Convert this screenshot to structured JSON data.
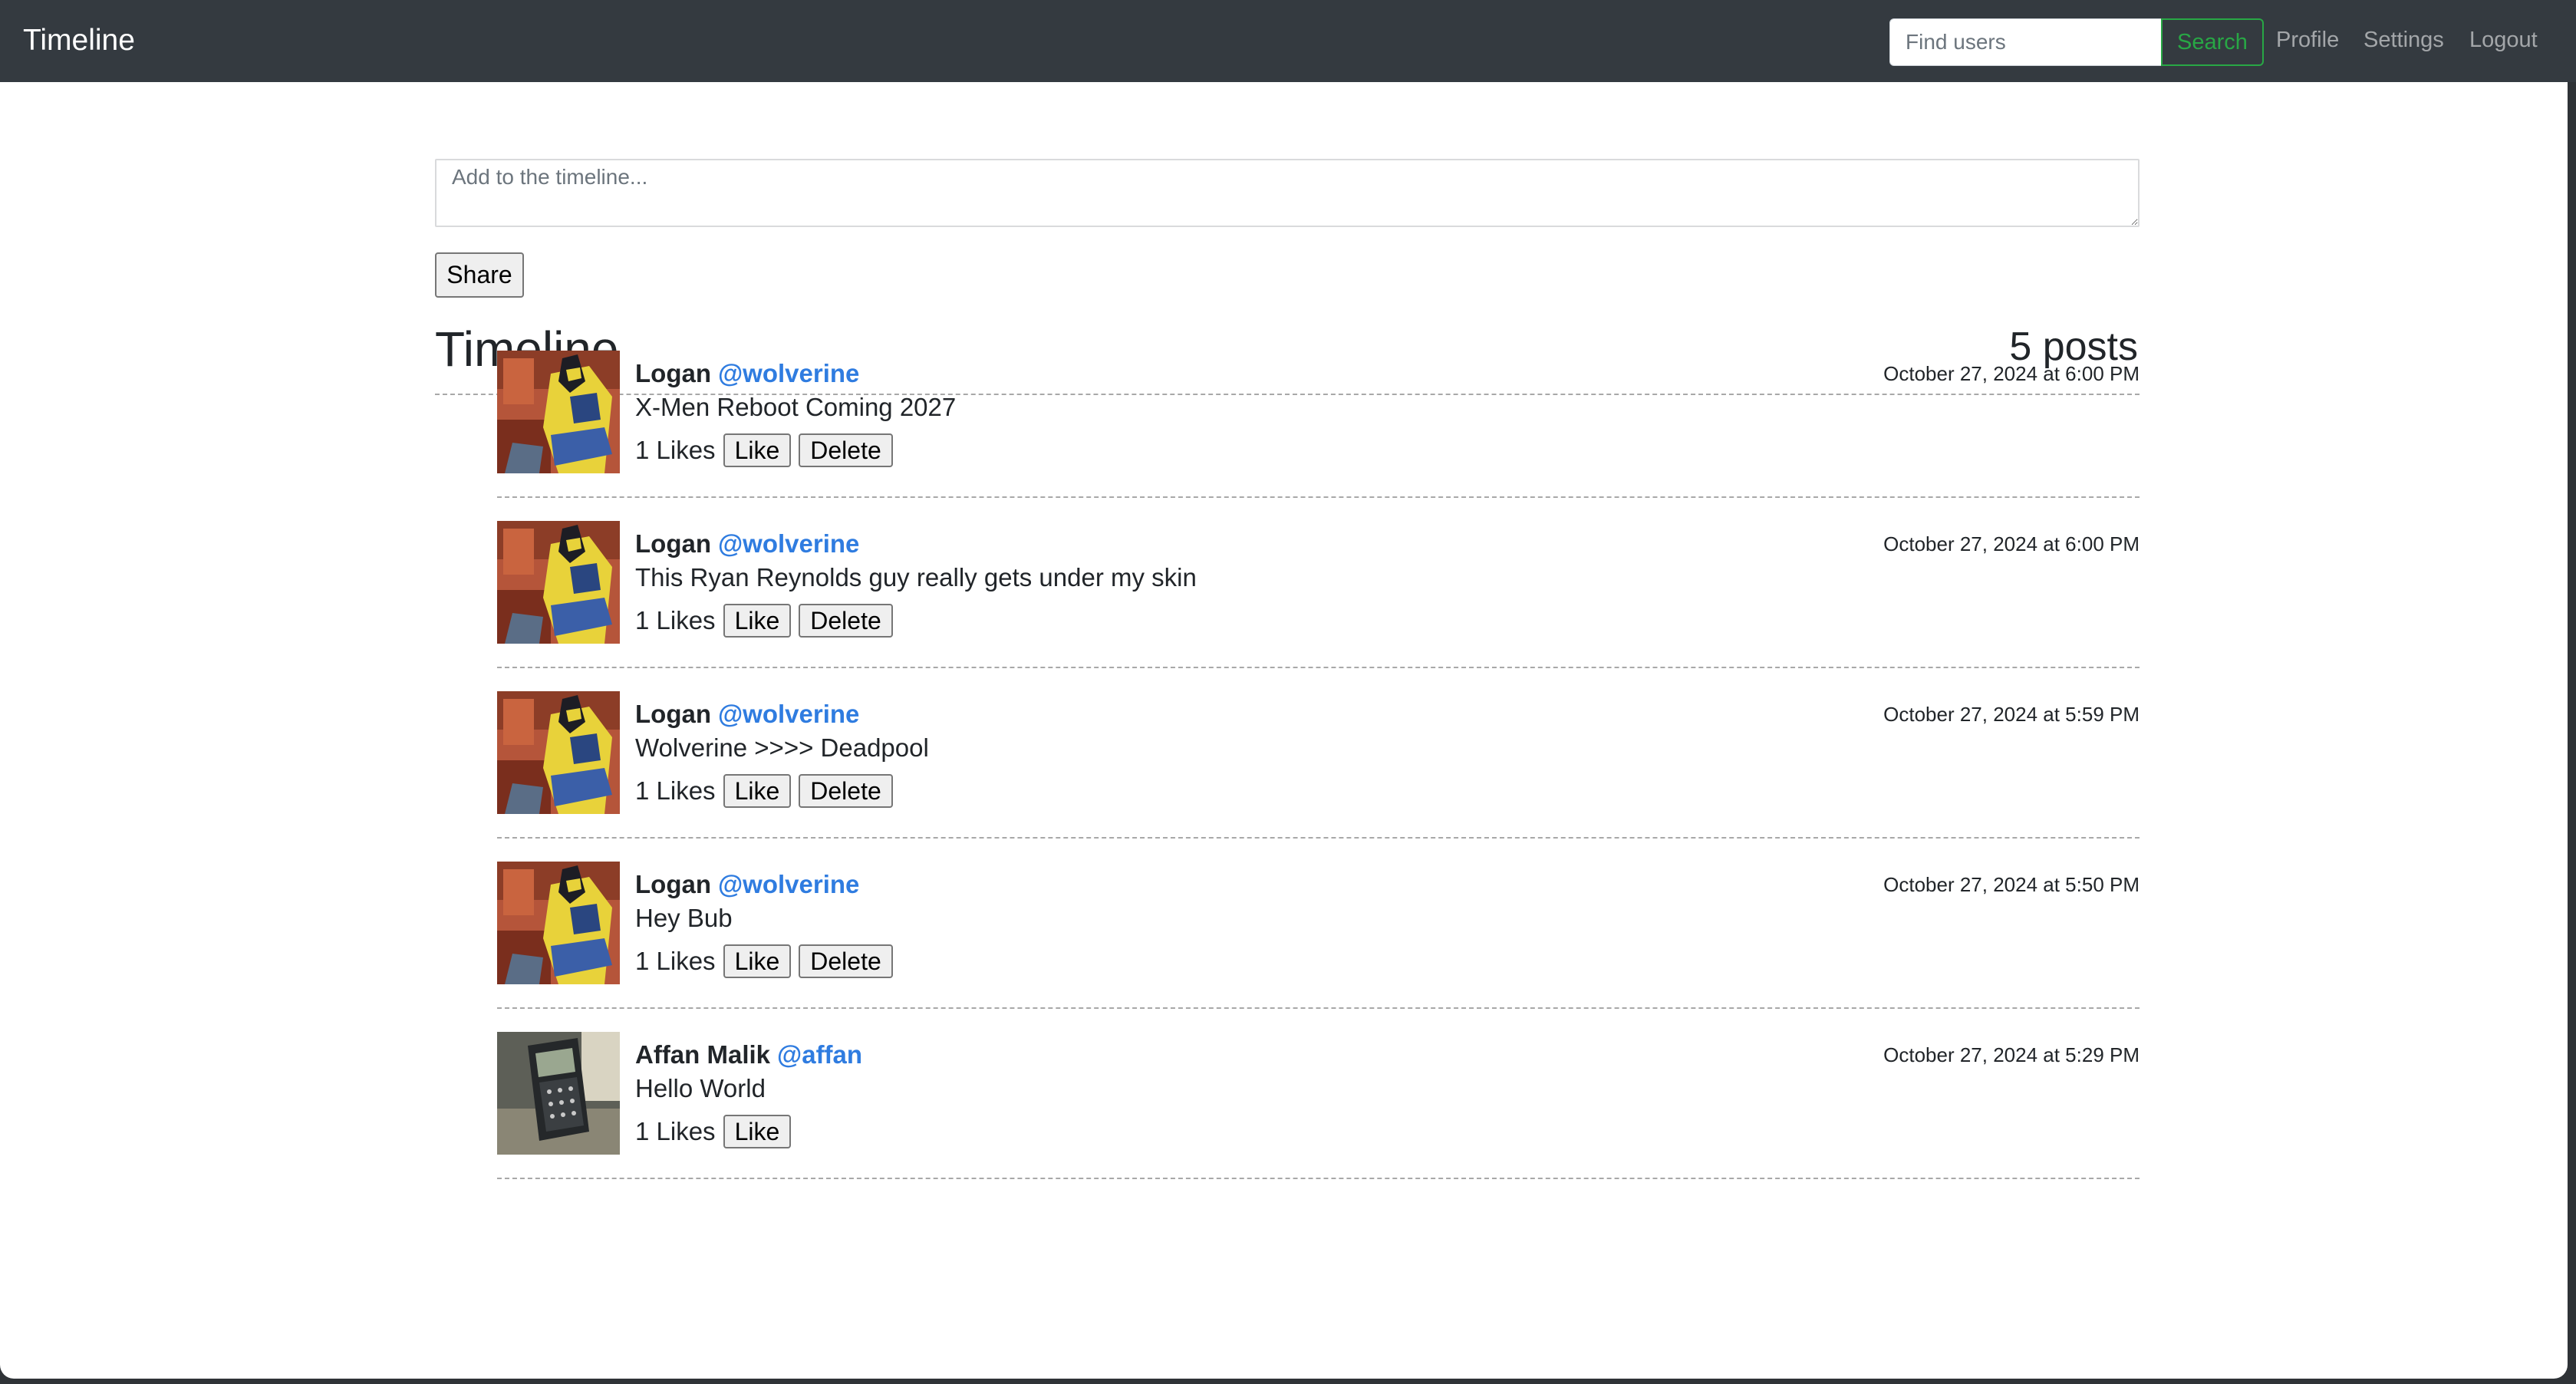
{
  "navbar": {
    "brand": "Timeline",
    "search": {
      "placeholder": "Find users",
      "button_label": "Search"
    },
    "links": {
      "profile": "Profile",
      "settings": "Settings",
      "logout": "Logout"
    }
  },
  "composer": {
    "placeholder": "Add to the timeline...",
    "value": "",
    "share_label": "Share"
  },
  "timeline": {
    "heading": "Timeline",
    "post_count": "5 posts",
    "posts": [
      {
        "name": "Logan",
        "handle": "@wolverine",
        "text": "X-Men Reboot Coming 2027",
        "date": "October 27, 2024 at 6:00 PM",
        "likes": "1 Likes",
        "like_label": "Like",
        "delete_label": "Delete",
        "avatar": "wolverine-avatar"
      },
      {
        "name": "Logan",
        "handle": "@wolverine",
        "text": "This Ryan Reynolds guy really gets under my skin",
        "date": "October 27, 2024 at 6:00 PM",
        "likes": "1 Likes",
        "like_label": "Like",
        "delete_label": "Delete",
        "avatar": "wolverine-avatar"
      },
      {
        "name": "Logan",
        "handle": "@wolverine",
        "text": "Wolverine >>>> Deadpool",
        "date": "October 27, 2024 at 5:59 PM",
        "likes": "1 Likes",
        "like_label": "Like",
        "delete_label": "Delete",
        "avatar": "wolverine-avatar"
      },
      {
        "name": "Logan",
        "handle": "@wolverine",
        "text": "Hey Bub",
        "date": "October 27, 2024 at 5:50 PM",
        "likes": "1 Likes",
        "like_label": "Like",
        "delete_label": "Delete",
        "avatar": "wolverine-avatar"
      },
      {
        "name": "Affan Malik",
        "handle": "@affan",
        "text": "Hello World",
        "date": "October 27, 2024 at 5:29 PM",
        "likes": "1 Likes",
        "like_label": "Like",
        "avatar": "calculator-avatar"
      }
    ]
  },
  "colors": {
    "navbar_bg": "#343a40",
    "search_button": "#28a745",
    "handle_link": "#2f7ce0",
    "nav_link": "rgba(255,255,255,0.55)"
  }
}
